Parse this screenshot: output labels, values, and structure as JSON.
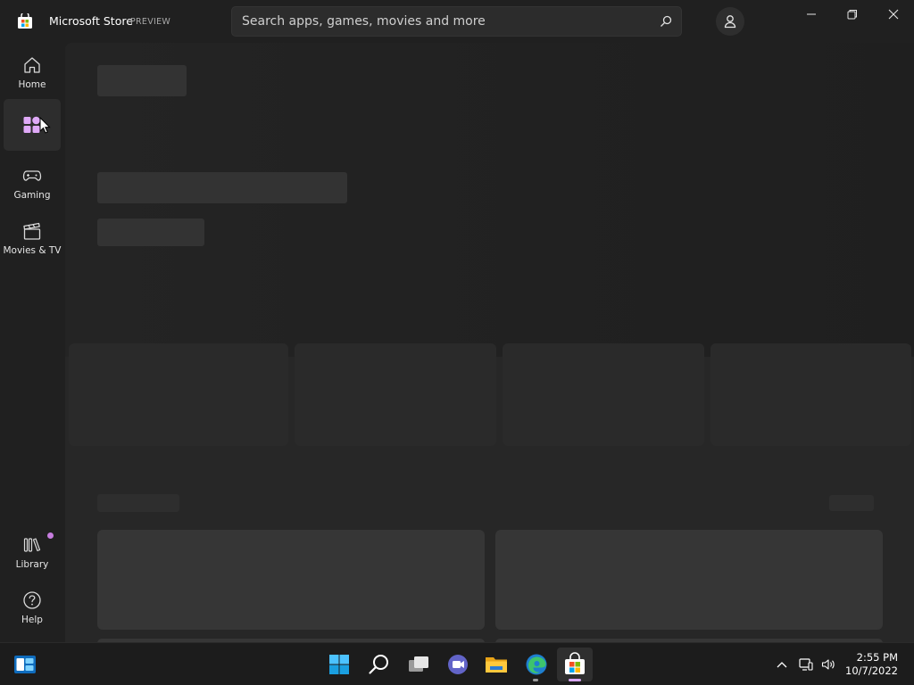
{
  "titlebar": {
    "app_title": "Microsoft Store",
    "preview_label": "PREVIEW",
    "search_placeholder": "Search apps, games, movies and more"
  },
  "sidebar": {
    "items": [
      {
        "label": "Home",
        "icon": "home-icon"
      },
      {
        "label": "",
        "icon": "apps-icon",
        "active": true
      },
      {
        "label": "Gaming",
        "icon": "gamepad-icon"
      },
      {
        "label": "Movies & TV",
        "icon": "clapperboard-icon"
      }
    ],
    "bottom_items": [
      {
        "label": "Library",
        "icon": "library-icon"
      },
      {
        "label": "Help",
        "icon": "help-icon"
      }
    ]
  },
  "taskbar": {
    "time": "2:55 PM",
    "date": "10/7/2022",
    "apps": [
      "widgets-icon",
      "start-icon",
      "search-icon",
      "task-view-icon",
      "chat-icon",
      "file-explorer-icon",
      "edge-icon",
      "store-icon"
    ]
  },
  "colors": {
    "accent": "#d8a7f5",
    "background": "#202020",
    "content": "#272727"
  }
}
